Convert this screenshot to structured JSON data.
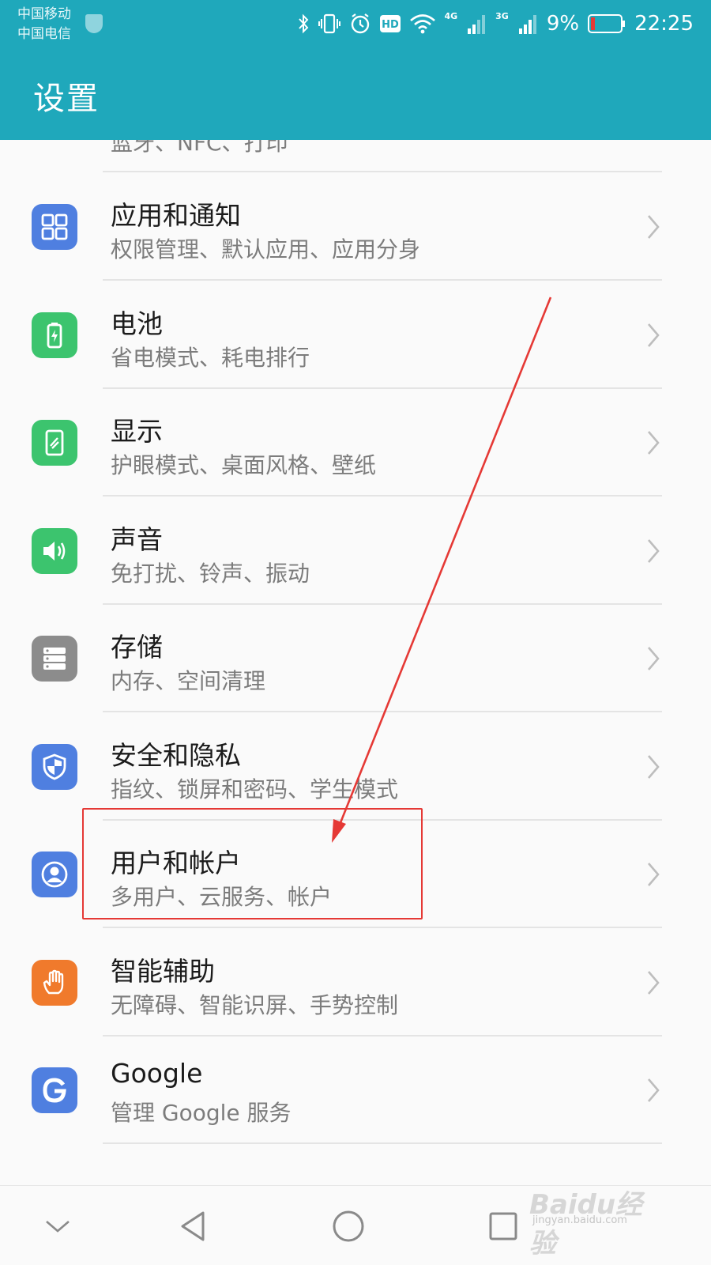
{
  "status_bar": {
    "carrier_1": "中国移动",
    "carrier_2": "中国电信",
    "network_1": "4G",
    "network_2": "3G",
    "battery_percent": "9%",
    "time": "22:25",
    "icons": [
      "bluetooth-icon",
      "vibrate-icon",
      "alarm-icon",
      "hd-icon",
      "wifi-icon",
      "signal-icon",
      "signal-icon",
      "battery-icon"
    ]
  },
  "app_bar": {
    "title": "设置"
  },
  "list": {
    "partial_top_subtitle": "蓝牙、NFC、打印",
    "items": [
      {
        "title": "应用和通知",
        "subtitle": "权限管理、默认应用、应用分身",
        "icon": "apps-icon",
        "icon_color": "#4f7fe0"
      },
      {
        "title": "电池",
        "subtitle": "省电模式、耗电排行",
        "icon": "battery-icon",
        "icon_color": "#3cc46e"
      },
      {
        "title": "显示",
        "subtitle": "护眼模式、桌面风格、壁纸",
        "icon": "display-icon",
        "icon_color": "#3cc46e"
      },
      {
        "title": "声音",
        "subtitle": "免打扰、铃声、振动",
        "icon": "sound-icon",
        "icon_color": "#3cc46e"
      },
      {
        "title": "存储",
        "subtitle": "内存、空间清理",
        "icon": "storage-icon",
        "icon_color": "#8c8c8c"
      },
      {
        "title": "安全和隐私",
        "subtitle": "指纹、锁屏和密码、学生模式",
        "icon": "shield-icon",
        "icon_color": "#4f7fe0"
      },
      {
        "title": "用户和帐户",
        "subtitle": "多用户、云服务、帐户",
        "icon": "user-icon",
        "icon_color": "#4f7fe0"
      },
      {
        "title": "智能辅助",
        "subtitle": "无障碍、智能识屏、手势控制",
        "icon": "hand-icon",
        "icon_color": "#f07a2c"
      },
      {
        "title": "Google",
        "subtitle": "管理 Google 服务",
        "icon": "google-icon",
        "icon_color": "#4f7fe0"
      }
    ]
  },
  "annotation": {
    "highlight_color": "#e53935",
    "highlighted_item": "用户和帐户"
  },
  "nav_bar": {
    "buttons": [
      "collapse",
      "back",
      "home",
      "recents"
    ]
  },
  "watermark": {
    "brand": "Baidu经验",
    "url": "jingyan.baidu.com"
  }
}
